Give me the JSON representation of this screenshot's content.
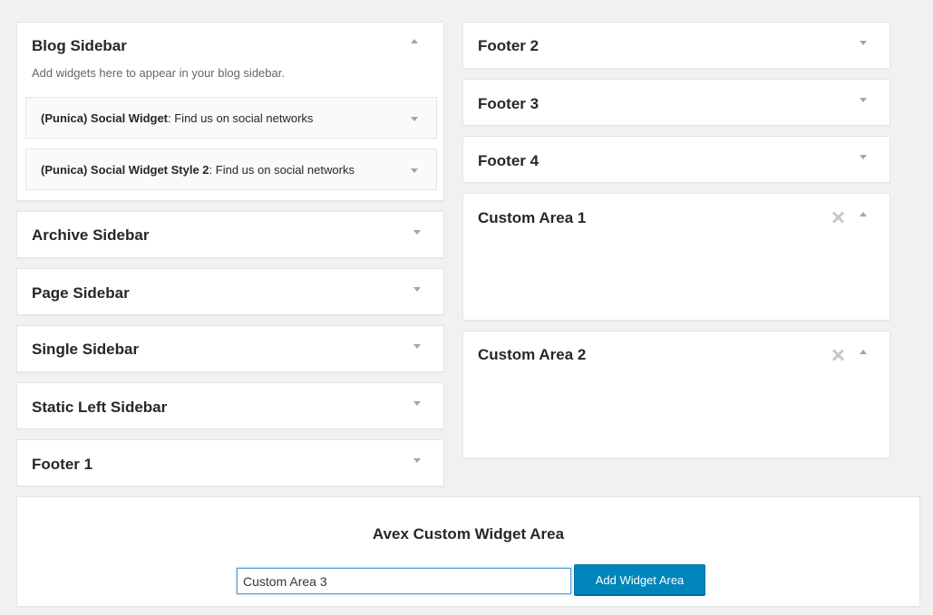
{
  "left_column": {
    "blog_sidebar": {
      "title": "Blog Sidebar",
      "description": "Add widgets here to appear in your blog sidebar.",
      "widgets": [
        {
          "name": "(Punica) Social Widget",
          "title": ": Find us on social networks"
        },
        {
          "name": "(Punica) Social Widget Style 2",
          "title": ": Find us on social networks"
        }
      ]
    },
    "archive_sidebar": {
      "title": "Archive Sidebar"
    },
    "page_sidebar": {
      "title": "Page Sidebar"
    },
    "single_sidebar": {
      "title": "Single Sidebar"
    },
    "static_left_sidebar": {
      "title": "Static Left Sidebar"
    },
    "footer_1": {
      "title": "Footer 1"
    }
  },
  "right_column": {
    "footer_2": {
      "title": "Footer 2"
    },
    "footer_3": {
      "title": "Footer 3"
    },
    "footer_4": {
      "title": "Footer 4"
    },
    "custom_area_1": {
      "title": "Custom Area 1"
    },
    "custom_area_2": {
      "title": "Custom Area 2"
    }
  },
  "custom_widget_form": {
    "title": "Avex Custom Widget Area",
    "input_value": "Custom Area 3",
    "button_label": "Add Widget Area"
  },
  "icons": {
    "collapse": "caret-up-icon",
    "expand": "caret-down-icon",
    "remove": "close-icon"
  },
  "colors": {
    "background": "#f1f1f1",
    "panel": "#ffffff",
    "primary_button": "#0085ba",
    "text": "#23282d"
  }
}
